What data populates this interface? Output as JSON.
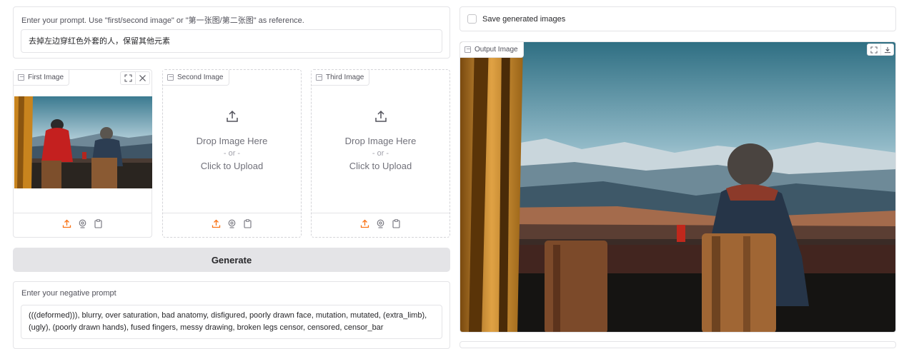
{
  "prompt": {
    "label": "Enter your prompt. Use \"first/second image\" or \"第一张图/第二张图\" as reference.",
    "value": "去掉左边穿红色外套的人，保留其他元素"
  },
  "images": {
    "first": {
      "label": "First Image"
    },
    "second": {
      "label": "Second Image",
      "drop": "Drop Image Here",
      "or": "- or -",
      "click": "Click to Upload"
    },
    "third": {
      "label": "Third Image",
      "drop": "Drop Image Here",
      "or": "- or -",
      "click": "Click to Upload"
    }
  },
  "generate": {
    "label": "Generate"
  },
  "negative_prompt": {
    "label": "Enter your negative prompt",
    "value": "(((deformed))), blurry, over saturation, bad anatomy, disfigured, poorly drawn face, mutation, mutated, (extra_limb), (ugly), (poorly drawn hands), fused fingers, messy drawing, broken legs censor, censored, censor_bar"
  },
  "save": {
    "label": "Save generated images",
    "checked": false
  },
  "output": {
    "label": "Output Image"
  },
  "icons": {
    "upload": "upload-icon",
    "webcam": "webcam-icon",
    "clipboard": "clipboard-icon",
    "fullscreen": "fullscreen-icon",
    "close": "close-icon",
    "download": "download-icon",
    "image": "image-icon"
  },
  "colors": {
    "accent": "#f97316",
    "button_bg": "#e4e4e7",
    "border": "#e4e4e7"
  }
}
